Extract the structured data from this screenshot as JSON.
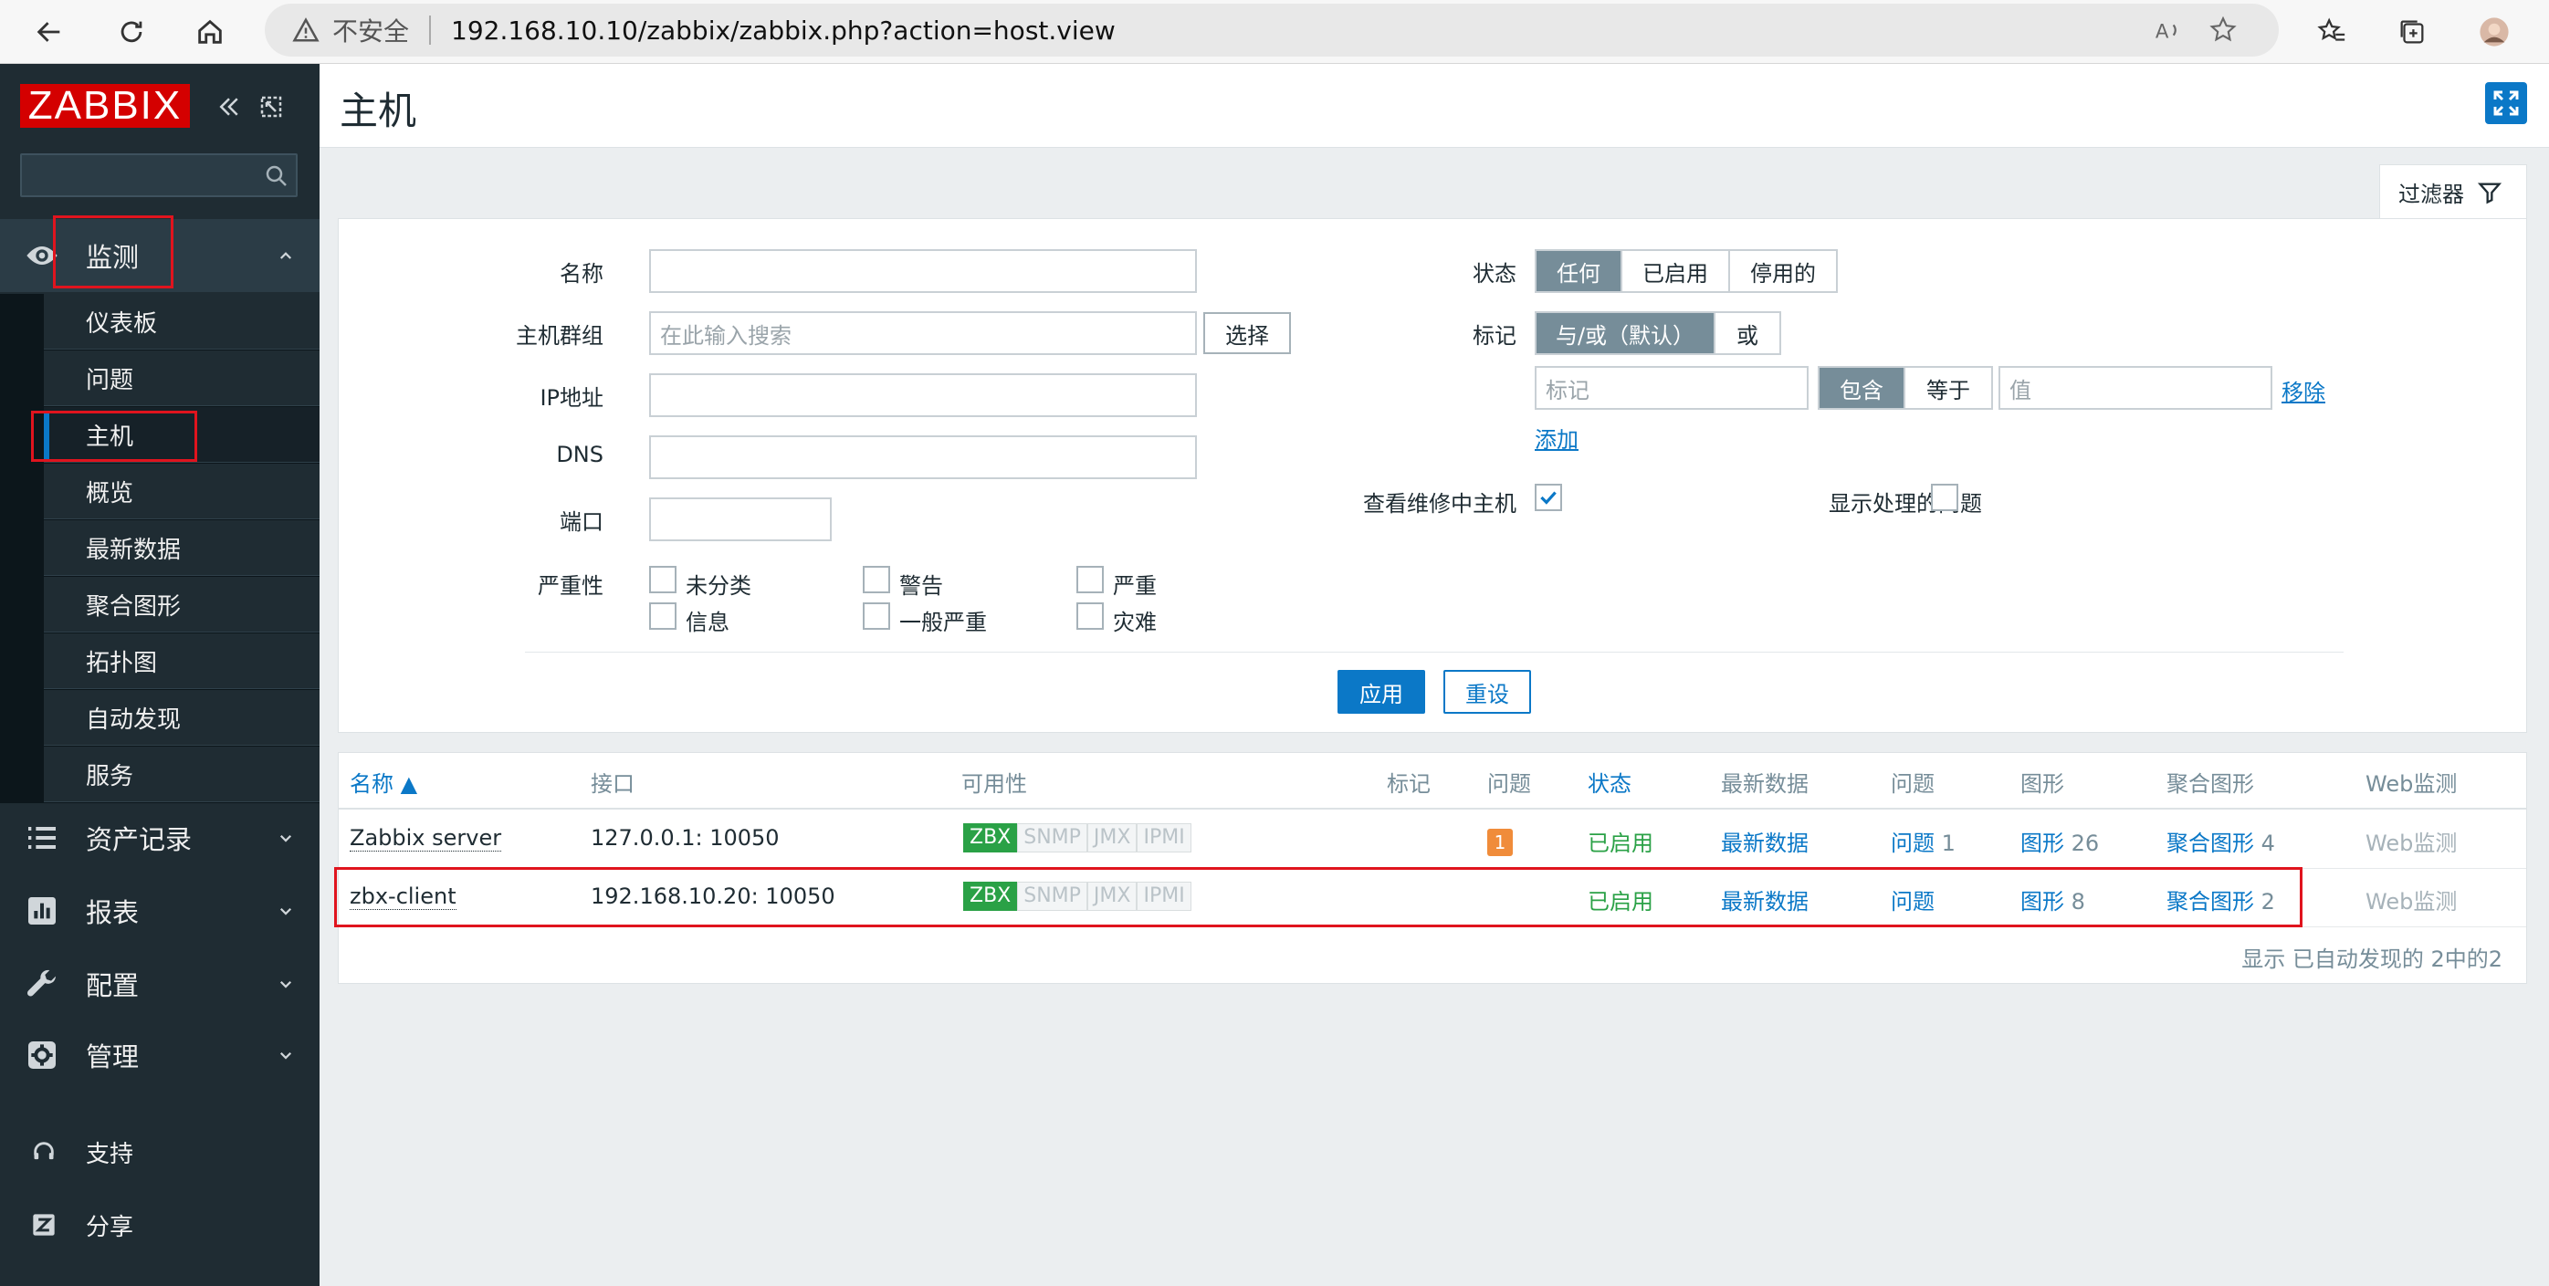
{
  "browser": {
    "insecure_label": "不安全",
    "url": "192.168.10.10/zabbix/zabbix.php?action=host.view"
  },
  "sidebar": {
    "logo": "ZABBIX",
    "search_placeholder": "",
    "monitoring_label": "监测",
    "submenu": [
      "仪表板",
      "问题",
      "主机",
      "概览",
      "最新数据",
      "聚合图形",
      "拓扑图",
      "自动发现",
      "服务"
    ],
    "active_submenu": "主机",
    "inventory_label": "资产记录",
    "reports_label": "报表",
    "config_label": "配置",
    "admin_label": "管理",
    "support_label": "支持",
    "share_label": "分享"
  },
  "header": {
    "title": "主机"
  },
  "filter": {
    "tab_label": "过滤器",
    "name_label": "名称",
    "hostgroup_label": "主机群组",
    "hostgroup_placeholder": "在此输入搜索",
    "select_button": "选择",
    "ip_label": "IP地址",
    "dns_label": "DNS",
    "port_label": "端口",
    "severity_label": "严重性",
    "severities": [
      "未分类",
      "警告",
      "严重",
      "信息",
      "一般严重",
      "灾难"
    ],
    "status_label": "状态",
    "status_options": [
      "任何",
      "已启用",
      "停用的"
    ],
    "status_selected": "任何",
    "tags_label": "标记",
    "tag_mode_options": [
      "与/或（默认）",
      "或"
    ],
    "tag_mode_selected": "与/或（默认）",
    "tag_placeholder": "标记",
    "tag_operator_options": [
      "包含",
      "等于"
    ],
    "tag_operator_selected": "包含",
    "value_placeholder": "值",
    "remove_link": "移除",
    "add_link": "添加",
    "show_maintenance_label": "查看维修中主机",
    "show_maintenance_checked": true,
    "show_suppressed_label": "显示处理的问题",
    "show_suppressed_checked": false,
    "apply_button": "应用",
    "reset_button": "重设"
  },
  "table": {
    "columns": [
      "名称 ▲",
      "接口",
      "可用性",
      "标记",
      "问题",
      "状态",
      "最新数据",
      "问题",
      "图形",
      "聚合图形",
      "Web监测"
    ],
    "rows": [
      {
        "name": "Zabbix server",
        "interface": "127.0.0.1: 10050",
        "availability": [
          "ZBX",
          "SNMP",
          "JMX",
          "IPMI"
        ],
        "problems_badge": "1",
        "status": "已启用",
        "latest": "最新数据",
        "problems_link": "问题",
        "problems_count": "1",
        "graphs_link": "图形",
        "graphs_count": "26",
        "screens_link": "聚合图形",
        "screens_count": "4",
        "web": "Web监测"
      },
      {
        "name": "zbx-client",
        "interface": "192.168.10.20: 10050",
        "availability": [
          "ZBX",
          "SNMP",
          "JMX",
          "IPMI"
        ],
        "problems_badge": "",
        "status": "已启用",
        "latest": "最新数据",
        "problems_link": "问题",
        "problems_count": "",
        "graphs_link": "图形",
        "graphs_count": "8",
        "screens_link": "聚合图形",
        "screens_count": "2",
        "web": "Web监测"
      }
    ],
    "footer": "显示 已自动发现的 2中的2"
  },
  "colors": {
    "sidebar_bg": "#1f2c33",
    "accent": "#0b78c7",
    "logo_red": "#d40000",
    "annotation_red": "#e0141e",
    "available_green": "#2aa146",
    "problem_orange": "#f08c3a"
  }
}
